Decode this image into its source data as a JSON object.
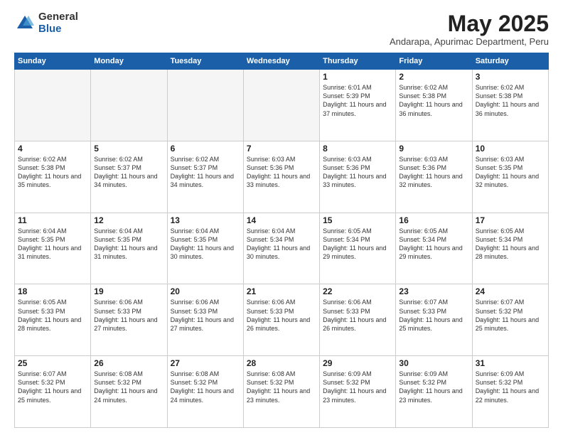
{
  "header": {
    "logo_general": "General",
    "logo_blue": "Blue",
    "month_title": "May 2025",
    "subtitle": "Andarapa, Apurimac Department, Peru"
  },
  "weekdays": [
    "Sunday",
    "Monday",
    "Tuesday",
    "Wednesday",
    "Thursday",
    "Friday",
    "Saturday"
  ],
  "rows": [
    [
      {
        "day": "",
        "text": ""
      },
      {
        "day": "",
        "text": ""
      },
      {
        "day": "",
        "text": ""
      },
      {
        "day": "",
        "text": ""
      },
      {
        "day": "1",
        "text": "Sunrise: 6:01 AM\nSunset: 5:39 PM\nDaylight: 11 hours and 37 minutes."
      },
      {
        "day": "2",
        "text": "Sunrise: 6:02 AM\nSunset: 5:38 PM\nDaylight: 11 hours and 36 minutes."
      },
      {
        "day": "3",
        "text": "Sunrise: 6:02 AM\nSunset: 5:38 PM\nDaylight: 11 hours and 36 minutes."
      }
    ],
    [
      {
        "day": "4",
        "text": "Sunrise: 6:02 AM\nSunset: 5:38 PM\nDaylight: 11 hours and 35 minutes."
      },
      {
        "day": "5",
        "text": "Sunrise: 6:02 AM\nSunset: 5:37 PM\nDaylight: 11 hours and 34 minutes."
      },
      {
        "day": "6",
        "text": "Sunrise: 6:02 AM\nSunset: 5:37 PM\nDaylight: 11 hours and 34 minutes."
      },
      {
        "day": "7",
        "text": "Sunrise: 6:03 AM\nSunset: 5:36 PM\nDaylight: 11 hours and 33 minutes."
      },
      {
        "day": "8",
        "text": "Sunrise: 6:03 AM\nSunset: 5:36 PM\nDaylight: 11 hours and 33 minutes."
      },
      {
        "day": "9",
        "text": "Sunrise: 6:03 AM\nSunset: 5:36 PM\nDaylight: 11 hours and 32 minutes."
      },
      {
        "day": "10",
        "text": "Sunrise: 6:03 AM\nSunset: 5:35 PM\nDaylight: 11 hours and 32 minutes."
      }
    ],
    [
      {
        "day": "11",
        "text": "Sunrise: 6:04 AM\nSunset: 5:35 PM\nDaylight: 11 hours and 31 minutes."
      },
      {
        "day": "12",
        "text": "Sunrise: 6:04 AM\nSunset: 5:35 PM\nDaylight: 11 hours and 31 minutes."
      },
      {
        "day": "13",
        "text": "Sunrise: 6:04 AM\nSunset: 5:35 PM\nDaylight: 11 hours and 30 minutes."
      },
      {
        "day": "14",
        "text": "Sunrise: 6:04 AM\nSunset: 5:34 PM\nDaylight: 11 hours and 30 minutes."
      },
      {
        "day": "15",
        "text": "Sunrise: 6:05 AM\nSunset: 5:34 PM\nDaylight: 11 hours and 29 minutes."
      },
      {
        "day": "16",
        "text": "Sunrise: 6:05 AM\nSunset: 5:34 PM\nDaylight: 11 hours and 29 minutes."
      },
      {
        "day": "17",
        "text": "Sunrise: 6:05 AM\nSunset: 5:34 PM\nDaylight: 11 hours and 28 minutes."
      }
    ],
    [
      {
        "day": "18",
        "text": "Sunrise: 6:05 AM\nSunset: 5:33 PM\nDaylight: 11 hours and 28 minutes."
      },
      {
        "day": "19",
        "text": "Sunrise: 6:06 AM\nSunset: 5:33 PM\nDaylight: 11 hours and 27 minutes."
      },
      {
        "day": "20",
        "text": "Sunrise: 6:06 AM\nSunset: 5:33 PM\nDaylight: 11 hours and 27 minutes."
      },
      {
        "day": "21",
        "text": "Sunrise: 6:06 AM\nSunset: 5:33 PM\nDaylight: 11 hours and 26 minutes."
      },
      {
        "day": "22",
        "text": "Sunrise: 6:06 AM\nSunset: 5:33 PM\nDaylight: 11 hours and 26 minutes."
      },
      {
        "day": "23",
        "text": "Sunrise: 6:07 AM\nSunset: 5:33 PM\nDaylight: 11 hours and 25 minutes."
      },
      {
        "day": "24",
        "text": "Sunrise: 6:07 AM\nSunset: 5:32 PM\nDaylight: 11 hours and 25 minutes."
      }
    ],
    [
      {
        "day": "25",
        "text": "Sunrise: 6:07 AM\nSunset: 5:32 PM\nDaylight: 11 hours and 25 minutes."
      },
      {
        "day": "26",
        "text": "Sunrise: 6:08 AM\nSunset: 5:32 PM\nDaylight: 11 hours and 24 minutes."
      },
      {
        "day": "27",
        "text": "Sunrise: 6:08 AM\nSunset: 5:32 PM\nDaylight: 11 hours and 24 minutes."
      },
      {
        "day": "28",
        "text": "Sunrise: 6:08 AM\nSunset: 5:32 PM\nDaylight: 11 hours and 23 minutes."
      },
      {
        "day": "29",
        "text": "Sunrise: 6:09 AM\nSunset: 5:32 PM\nDaylight: 11 hours and 23 minutes."
      },
      {
        "day": "30",
        "text": "Sunrise: 6:09 AM\nSunset: 5:32 PM\nDaylight: 11 hours and 23 minutes."
      },
      {
        "day": "31",
        "text": "Sunrise: 6:09 AM\nSunset: 5:32 PM\nDaylight: 11 hours and 22 minutes."
      }
    ]
  ]
}
